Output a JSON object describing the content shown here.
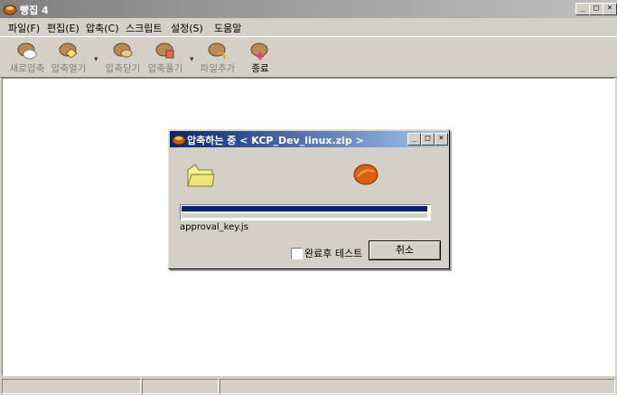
{
  "app": {
    "title": "빵집 4",
    "window_buttons": {
      "minimize": "_",
      "maximize": "□",
      "close": "×"
    }
  },
  "menu": [
    {
      "label": "파일(F)"
    },
    {
      "label": "편집(E)"
    },
    {
      "label": "압축(C)"
    },
    {
      "label": "스크립트"
    },
    {
      "label": "설정(S)"
    },
    {
      "label": "도움말"
    }
  ],
  "toolbar": [
    {
      "label": "새로압축",
      "icon": "new-archive-icon"
    },
    {
      "label": "압축열기",
      "icon": "open-archive-icon"
    },
    {
      "label": "압축닫기",
      "icon": "close-archive-icon"
    },
    {
      "label": "압축풀기",
      "icon": "extract-archive-icon"
    },
    {
      "label": "파일추가",
      "icon": "add-file-icon"
    },
    {
      "label": "종료",
      "icon": "exit-icon"
    }
  ],
  "toolbar_separator": "▾",
  "dialog": {
    "title": "압축하는 중 < KCP_Dev_linux.zip >",
    "progress": 1.0,
    "current_file": "approval_key.js",
    "checkbox_label": "완료후 테스트",
    "checkbox_checked": false,
    "cancel_label": "취소",
    "window_buttons": {
      "minimize": "_",
      "maximize": "□",
      "close": "×"
    }
  },
  "colors": {
    "title_active_start": "#0a246a",
    "title_active_end": "#a6caf0",
    "title_inactive_start": "#808080",
    "title_inactive_end": "#c0c0c0",
    "face": "#d4d0c8",
    "progress": "#0a246a"
  }
}
